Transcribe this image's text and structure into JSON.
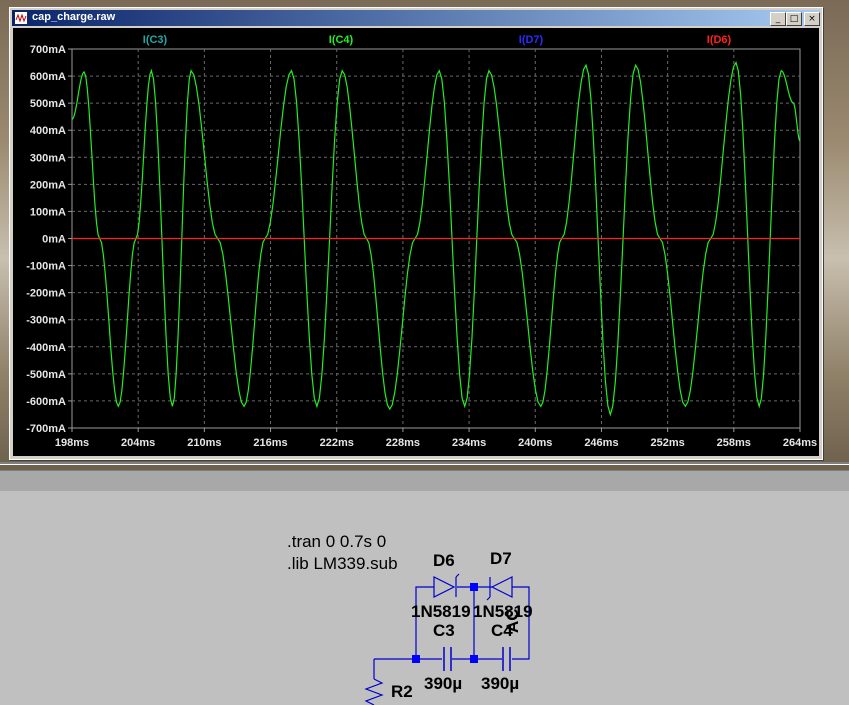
{
  "window": {
    "title": "cap_charge.raw"
  },
  "titlebar_buttons": {
    "minimize": "_",
    "maximize": "□",
    "close": "×"
  },
  "plot": {
    "traces": [
      {
        "label": "I(C3)",
        "color": "#1fa7a7"
      },
      {
        "label": "I(C4)",
        "color": "#22ee22"
      },
      {
        "label": "I(D7)",
        "color": "#2b2bff"
      },
      {
        "label": "I(D6)",
        "color": "#ff2020"
      }
    ],
    "y_ticks": [
      "700mA",
      "600mA",
      "500mA",
      "400mA",
      "300mA",
      "200mA",
      "100mA",
      "0mA",
      "-100mA",
      "-200mA",
      "-300mA",
      "-400mA",
      "-500mA",
      "-600mA",
      "-700mA"
    ],
    "x_ticks": [
      "198ms",
      "204ms",
      "210ms",
      "216ms",
      "222ms",
      "228ms",
      "234ms",
      "240ms",
      "246ms",
      "252ms",
      "258ms",
      "264ms"
    ]
  },
  "chart_data": {
    "type": "line",
    "xlabel": "",
    "ylabel": "",
    "xlim": [
      198,
      264
    ],
    "ylim": [
      -700,
      700
    ],
    "grid": true,
    "series": [
      {
        "name": "I(C4)",
        "color": "#22ee22",
        "x": [
          198,
          199.1,
          200.5,
          202.2,
          203.8,
          205.2,
          207.1,
          208.8,
          211.2,
          213.6,
          215.5,
          217.9,
          220.2,
          222.5,
          224.7,
          226.8,
          229.1,
          231.3,
          233.6,
          235.8,
          238.1,
          240.5,
          242.4,
          244.6,
          246.8,
          249.1,
          251.3,
          253.6,
          255.9,
          258.2,
          260.3,
          262.3,
          263.4,
          264
        ],
        "y": [
          440,
          615,
          0,
          -620,
          0,
          620,
          -620,
          620,
          0,
          -620,
          0,
          620,
          -620,
          620,
          0,
          -630,
          0,
          620,
          -620,
          620,
          0,
          -620,
          0,
          640,
          -650,
          640,
          0,
          -620,
          0,
          650,
          -620,
          620,
          500,
          360
        ]
      },
      {
        "name": "I(D6)",
        "color": "#ff2020",
        "x": [
          198,
          264
        ],
        "y": [
          0,
          0
        ]
      }
    ]
  },
  "schematic": {
    "directives": [
      ".tran 0 0.7s 0",
      ".lib LM339.sub"
    ],
    "d6": {
      "name": "D6",
      "model": "1N5819"
    },
    "d7": {
      "name": "D7",
      "model": "1N5819"
    },
    "c3": {
      "name": "C3",
      "value": "390µ"
    },
    "c4": {
      "name": "C4",
      "value": "390µ"
    },
    "ac": "AC",
    "r2": "R2"
  }
}
